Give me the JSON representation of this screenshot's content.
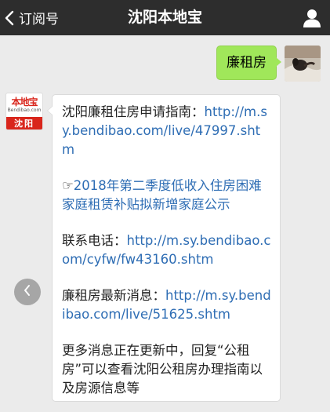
{
  "nav": {
    "back_label": "订阅号",
    "title": "沈阳本地宝",
    "profile_icon": "person-icon",
    "back_icon": "chevron-left-icon",
    "bg_color": "#2d2d2d"
  },
  "user_message": {
    "text": "廉租房",
    "bubble_color": "#a0e75a",
    "avatar_icon": "user-photo-avatar"
  },
  "bot": {
    "avatar": {
      "brand": "本地宝",
      "site": "Bendibao.com",
      "city": "沈阳",
      "brand_color": "#d9261c"
    },
    "reply": {
      "p1_label": "沈阳廉租住房申请指南：",
      "p1_link": "http://m.sy.bendibao.com/live/47997.shtm",
      "p2_prefix": "☞",
      "p2_link": "2018年第二季度低收入住房困难家庭租赁补贴拟新增家庭公示",
      "p3_label": "联系电话：",
      "p3_link": "http://m.sy.bendibao.com/cyfw/fw43160.shtm",
      "p4_label": "廉租房最新消息：",
      "p4_link": "http://m.sy.bendibao.com/live/51625.shtm",
      "p5_text": "更多消息正在更新中，回复“公租房”可以查看沈阳公租房办理指南以及房源信息等",
      "link_color": "#2e6db4"
    }
  },
  "slide_button_icon": "chevron-left-icon"
}
